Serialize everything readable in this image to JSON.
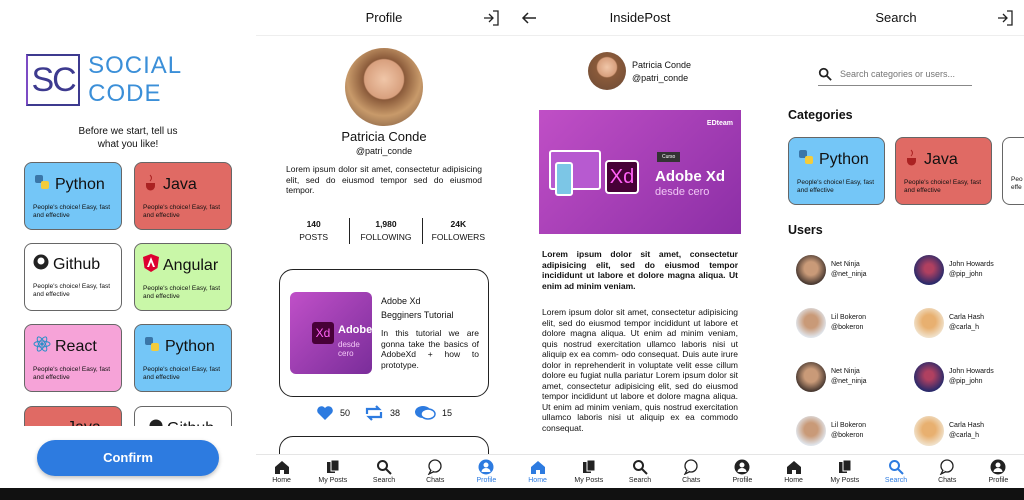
{
  "onboarding": {
    "logo_mark": "SC",
    "logo_text": "SOCIAL CODE",
    "prompt": "Before we start, tell us what you like!",
    "confirm": "Confirm",
    "cards": [
      {
        "name": "Python",
        "desc": "People's choice! Easy, fast and effective",
        "color": "#74c6f7"
      },
      {
        "name": "Java",
        "desc": "People's choice! Easy, fast and effective",
        "color": "#e06a64"
      },
      {
        "name": "Github",
        "desc": "People's choice! Easy, fast and effective",
        "color": "#ffffff"
      },
      {
        "name": "Angular",
        "desc": "People's choice! Easy, fast and effective",
        "color": "#c9f7a8"
      },
      {
        "name": "React",
        "desc": "People's choice! Easy, fast and effective",
        "color": "#f6a3d8"
      },
      {
        "name": "Python",
        "desc": "People's choice! Easy, fast and effective",
        "color": "#74c6f7"
      },
      {
        "name": "Java",
        "desc": "",
        "color": "#e06a64"
      },
      {
        "name": "Github",
        "desc": "",
        "color": "#ffffff"
      }
    ]
  },
  "profile": {
    "title": "Profile",
    "name": "Patricia Conde",
    "handle": "@patri_conde",
    "bio": "Lorem ipsum dolor sit amet, consectetur adipisicing elit, sed do eiusmod tempor sed do eiusmod tempor.",
    "stats": [
      {
        "value": "140",
        "label": "POSTS"
      },
      {
        "value": "1,980",
        "label": "FOLLOWING"
      },
      {
        "value": "24K",
        "label": "FOLLOWERS"
      }
    ],
    "post": {
      "title": "Adobe Xd",
      "subtitle": "Begginers Tutorial",
      "text": "In this tutorial we are gonna take the basics of AdobeXd + how to prototype.",
      "thumb_title": "Adobe",
      "thumb_sub": "desde cero"
    },
    "reactions": {
      "likes": "50",
      "shares": "38",
      "comments": "15"
    }
  },
  "inside": {
    "title": "InsidePost",
    "name": "Patricia Conde",
    "handle": "@patri_conde",
    "banner": {
      "brand": "EDteam",
      "tag": "Curso",
      "title": "Adobe Xd",
      "sub": "desde cero",
      "xd": "Xd"
    },
    "bold": "Lorem ipsum dolor sit amet, consectetur adipisicing elit, sed do eiusmod tempor incididunt ut labore et dolore magna aliqua. Ut enim ad minim veniam.",
    "body": "Lorem ipsum dolor sit amet, consectetur adipisicing elit, sed do eiusmod tempor incididunt ut labore et dolore magna aliqua. Ut enim ad minim veniam, quis nostrud exercitation ullamco laboris nisi ut aliquip ex ea comm- odo consequat. Duis aute irure dolor in reprehenderit in voluptate velit esse cillum dolore eu fugiat nulla pariatur Lorem ipsum dolor sit amet, consectetur adipisicing elit, sed do eiusmod tempor incididunt ut labore et dolore magna aliqua. Ut enim ad minim veniam, quis nostrud exercitation ullamco laboris nisi ut aliquip ex ea commodo consequat."
  },
  "search": {
    "title": "Search",
    "placeholder": "Search categories or users...",
    "categories_heading": "Categories",
    "users_heading": "Users",
    "cats": [
      {
        "name": "Python",
        "desc": "People's choice! Easy, fast and effective"
      },
      {
        "name": "Java",
        "desc": "People's choice! Easy, fast and effective"
      },
      {
        "name": "",
        "desc": "Peo effe"
      }
    ],
    "users": [
      {
        "name": "Net Ninja",
        "handle": "@net_ninja"
      },
      {
        "name": "John Howards",
        "handle": "@pip_john"
      },
      {
        "name": "Lil Bokeron",
        "handle": "@bokeron"
      },
      {
        "name": "Carla Hash",
        "handle": "@carla_h"
      },
      {
        "name": "Net Ninja",
        "handle": "@net_ninja"
      },
      {
        "name": "John Howards",
        "handle": "@pip_john"
      },
      {
        "name": "Lil Bokeron",
        "handle": "@bokeron"
      },
      {
        "name": "Carla Hash",
        "handle": "@carla_h"
      }
    ]
  },
  "nav": {
    "home": "Home",
    "posts": "My Posts",
    "search": "Search",
    "chats": "Chats",
    "profile": "Profile"
  },
  "colors": {
    "accent": "#2d7be0",
    "purple": "#a43bbf",
    "logo": "#3d3a8f"
  }
}
